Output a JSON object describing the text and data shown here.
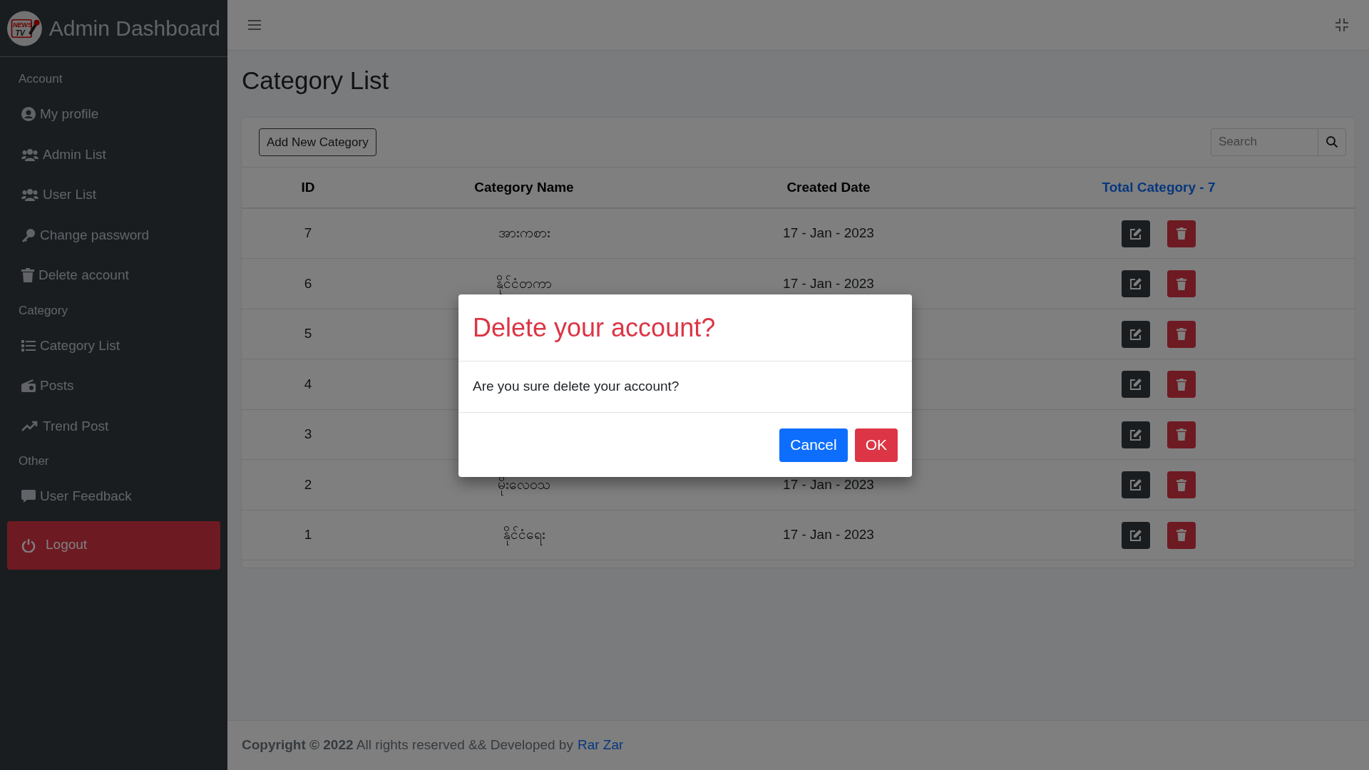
{
  "sidebar": {
    "logo": {
      "top": "NEWS",
      "bottom": "TV"
    },
    "title": "Admin Dashboard",
    "sections": [
      {
        "heading": "Account",
        "items": [
          {
            "label": "My profile"
          },
          {
            "label": "Admin List"
          },
          {
            "label": "User List"
          },
          {
            "label": "Change password"
          },
          {
            "label": "Delete account"
          }
        ]
      },
      {
        "heading": "Category",
        "items": [
          {
            "label": "Category List"
          },
          {
            "label": "Posts"
          },
          {
            "label": "Trend Post"
          }
        ]
      },
      {
        "heading": "Other",
        "items": [
          {
            "label": "User Feedback"
          }
        ]
      }
    ],
    "logout": "Logout"
  },
  "page_title": "Category List",
  "add_button": "Add New Category",
  "search": {
    "placeholder": "Search"
  },
  "table": {
    "columns": [
      "ID",
      "Category Name",
      "Created Date"
    ],
    "total": "Total Category - 7",
    "rows": [
      {
        "id": "7",
        "name": "အားကစား",
        "date": "17 - Jan - 2023"
      },
      {
        "id": "6",
        "name": "နိုင်ငံတကာ",
        "date": "17 - Jan - 2023"
      },
      {
        "id": "5"
      },
      {
        "id": "4"
      },
      {
        "id": "3"
      },
      {
        "id": "2",
        "name": "မိုးလေဝသ",
        "date": "17 - Jan - 2023"
      },
      {
        "id": "1",
        "name": "နိုင်ငံရေး",
        "date": "17 - Jan - 2023"
      }
    ]
  },
  "footer": {
    "text": "**Copyright © 2022** All rights reserved && Developed by",
    "link": "Rar Zar"
  },
  "modal": {
    "title": "Delete your account?",
    "body": "Are you sure delete your account?",
    "buttons": [
      {
        "label": "Cancel",
        "kind": "secondary"
      },
      {
        "label": "OK",
        "kind": "danger"
      }
    ]
  }
}
